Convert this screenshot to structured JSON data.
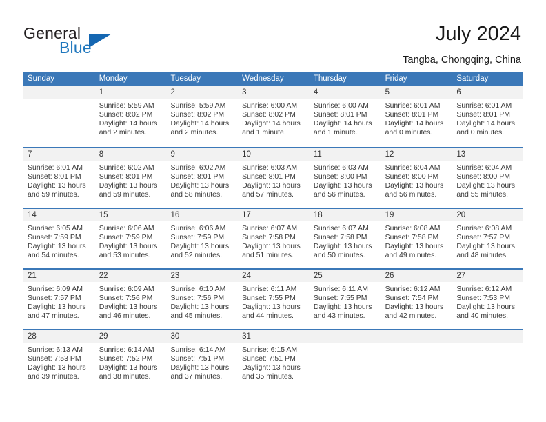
{
  "brand": {
    "name_part1": "General",
    "name_part2": "Blue"
  },
  "header": {
    "title": "July 2024",
    "location": "Tangba, Chongqing, China"
  },
  "colors": {
    "header_blue": "#3b78b8",
    "brand_blue": "#1f77bd",
    "day_band_gray": "#f2f2f2"
  },
  "weekdays": [
    "Sunday",
    "Monday",
    "Tuesday",
    "Wednesday",
    "Thursday",
    "Friday",
    "Saturday"
  ],
  "weeks": [
    [
      {
        "day": "",
        "sunrise": "",
        "sunset": "",
        "daylight1": "",
        "daylight2": ""
      },
      {
        "day": "1",
        "sunrise": "Sunrise: 5:59 AM",
        "sunset": "Sunset: 8:02 PM",
        "daylight1": "Daylight: 14 hours",
        "daylight2": "and 2 minutes."
      },
      {
        "day": "2",
        "sunrise": "Sunrise: 5:59 AM",
        "sunset": "Sunset: 8:02 PM",
        "daylight1": "Daylight: 14 hours",
        "daylight2": "and 2 minutes."
      },
      {
        "day": "3",
        "sunrise": "Sunrise: 6:00 AM",
        "sunset": "Sunset: 8:02 PM",
        "daylight1": "Daylight: 14 hours",
        "daylight2": "and 1 minute."
      },
      {
        "day": "4",
        "sunrise": "Sunrise: 6:00 AM",
        "sunset": "Sunset: 8:01 PM",
        "daylight1": "Daylight: 14 hours",
        "daylight2": "and 1 minute."
      },
      {
        "day": "5",
        "sunrise": "Sunrise: 6:01 AM",
        "sunset": "Sunset: 8:01 PM",
        "daylight1": "Daylight: 14 hours",
        "daylight2": "and 0 minutes."
      },
      {
        "day": "6",
        "sunrise": "Sunrise: 6:01 AM",
        "sunset": "Sunset: 8:01 PM",
        "daylight1": "Daylight: 14 hours",
        "daylight2": "and 0 minutes."
      }
    ],
    [
      {
        "day": "7",
        "sunrise": "Sunrise: 6:01 AM",
        "sunset": "Sunset: 8:01 PM",
        "daylight1": "Daylight: 13 hours",
        "daylight2": "and 59 minutes."
      },
      {
        "day": "8",
        "sunrise": "Sunrise: 6:02 AM",
        "sunset": "Sunset: 8:01 PM",
        "daylight1": "Daylight: 13 hours",
        "daylight2": "and 59 minutes."
      },
      {
        "day": "9",
        "sunrise": "Sunrise: 6:02 AM",
        "sunset": "Sunset: 8:01 PM",
        "daylight1": "Daylight: 13 hours",
        "daylight2": "and 58 minutes."
      },
      {
        "day": "10",
        "sunrise": "Sunrise: 6:03 AM",
        "sunset": "Sunset: 8:01 PM",
        "daylight1": "Daylight: 13 hours",
        "daylight2": "and 57 minutes."
      },
      {
        "day": "11",
        "sunrise": "Sunrise: 6:03 AM",
        "sunset": "Sunset: 8:00 PM",
        "daylight1": "Daylight: 13 hours",
        "daylight2": "and 56 minutes."
      },
      {
        "day": "12",
        "sunrise": "Sunrise: 6:04 AM",
        "sunset": "Sunset: 8:00 PM",
        "daylight1": "Daylight: 13 hours",
        "daylight2": "and 56 minutes."
      },
      {
        "day": "13",
        "sunrise": "Sunrise: 6:04 AM",
        "sunset": "Sunset: 8:00 PM",
        "daylight1": "Daylight: 13 hours",
        "daylight2": "and 55 minutes."
      }
    ],
    [
      {
        "day": "14",
        "sunrise": "Sunrise: 6:05 AM",
        "sunset": "Sunset: 7:59 PM",
        "daylight1": "Daylight: 13 hours",
        "daylight2": "and 54 minutes."
      },
      {
        "day": "15",
        "sunrise": "Sunrise: 6:06 AM",
        "sunset": "Sunset: 7:59 PM",
        "daylight1": "Daylight: 13 hours",
        "daylight2": "and 53 minutes."
      },
      {
        "day": "16",
        "sunrise": "Sunrise: 6:06 AM",
        "sunset": "Sunset: 7:59 PM",
        "daylight1": "Daylight: 13 hours",
        "daylight2": "and 52 minutes."
      },
      {
        "day": "17",
        "sunrise": "Sunrise: 6:07 AM",
        "sunset": "Sunset: 7:58 PM",
        "daylight1": "Daylight: 13 hours",
        "daylight2": "and 51 minutes."
      },
      {
        "day": "18",
        "sunrise": "Sunrise: 6:07 AM",
        "sunset": "Sunset: 7:58 PM",
        "daylight1": "Daylight: 13 hours",
        "daylight2": "and 50 minutes."
      },
      {
        "day": "19",
        "sunrise": "Sunrise: 6:08 AM",
        "sunset": "Sunset: 7:58 PM",
        "daylight1": "Daylight: 13 hours",
        "daylight2": "and 49 minutes."
      },
      {
        "day": "20",
        "sunrise": "Sunrise: 6:08 AM",
        "sunset": "Sunset: 7:57 PM",
        "daylight1": "Daylight: 13 hours",
        "daylight2": "and 48 minutes."
      }
    ],
    [
      {
        "day": "21",
        "sunrise": "Sunrise: 6:09 AM",
        "sunset": "Sunset: 7:57 PM",
        "daylight1": "Daylight: 13 hours",
        "daylight2": "and 47 minutes."
      },
      {
        "day": "22",
        "sunrise": "Sunrise: 6:09 AM",
        "sunset": "Sunset: 7:56 PM",
        "daylight1": "Daylight: 13 hours",
        "daylight2": "and 46 minutes."
      },
      {
        "day": "23",
        "sunrise": "Sunrise: 6:10 AM",
        "sunset": "Sunset: 7:56 PM",
        "daylight1": "Daylight: 13 hours",
        "daylight2": "and 45 minutes."
      },
      {
        "day": "24",
        "sunrise": "Sunrise: 6:11 AM",
        "sunset": "Sunset: 7:55 PM",
        "daylight1": "Daylight: 13 hours",
        "daylight2": "and 44 minutes."
      },
      {
        "day": "25",
        "sunrise": "Sunrise: 6:11 AM",
        "sunset": "Sunset: 7:55 PM",
        "daylight1": "Daylight: 13 hours",
        "daylight2": "and 43 minutes."
      },
      {
        "day": "26",
        "sunrise": "Sunrise: 6:12 AM",
        "sunset": "Sunset: 7:54 PM",
        "daylight1": "Daylight: 13 hours",
        "daylight2": "and 42 minutes."
      },
      {
        "day": "27",
        "sunrise": "Sunrise: 6:12 AM",
        "sunset": "Sunset: 7:53 PM",
        "daylight1": "Daylight: 13 hours",
        "daylight2": "and 40 minutes."
      }
    ],
    [
      {
        "day": "28",
        "sunrise": "Sunrise: 6:13 AM",
        "sunset": "Sunset: 7:53 PM",
        "daylight1": "Daylight: 13 hours",
        "daylight2": "and 39 minutes."
      },
      {
        "day": "29",
        "sunrise": "Sunrise: 6:14 AM",
        "sunset": "Sunset: 7:52 PM",
        "daylight1": "Daylight: 13 hours",
        "daylight2": "and 38 minutes."
      },
      {
        "day": "30",
        "sunrise": "Sunrise: 6:14 AM",
        "sunset": "Sunset: 7:51 PM",
        "daylight1": "Daylight: 13 hours",
        "daylight2": "and 37 minutes."
      },
      {
        "day": "31",
        "sunrise": "Sunrise: 6:15 AM",
        "sunset": "Sunset: 7:51 PM",
        "daylight1": "Daylight: 13 hours",
        "daylight2": "and 35 minutes."
      },
      {
        "day": "",
        "sunrise": "",
        "sunset": "",
        "daylight1": "",
        "daylight2": ""
      },
      {
        "day": "",
        "sunrise": "",
        "sunset": "",
        "daylight1": "",
        "daylight2": ""
      },
      {
        "day": "",
        "sunrise": "",
        "sunset": "",
        "daylight1": "",
        "daylight2": ""
      }
    ]
  ]
}
